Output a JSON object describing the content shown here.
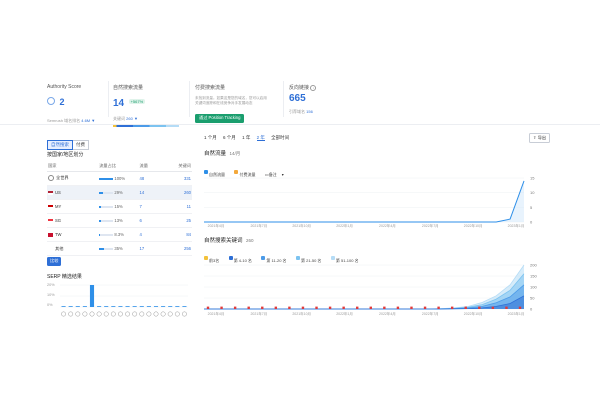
{
  "colors": {
    "accent": "#2e6fd6",
    "green": "#1a9e6e",
    "orange": "#f3a83b",
    "line": "#2e8fe8"
  },
  "header": {
    "authority": {
      "label": "Authority Score",
      "value": "2"
    },
    "semrush": {
      "label": "Semrush 域名排名",
      "value": "4.6M",
      "arrow": "▼"
    },
    "organic": {
      "label": "自然搜索流量",
      "value": "14",
      "badge": "+567%",
      "keywords_label": "关键词",
      "keywords_value": "260",
      "arrow": "▼"
    },
    "paid": {
      "label": "付费搜索流量",
      "desc1": "未找到流量。如果这是您的域名，您可以启用",
      "desc2": "关键词追踪和在线竞争对手发展动态",
      "button": "通过 Position Tracking"
    },
    "backlinks": {
      "label": "反向链接",
      "value": "665",
      "refdomains_label": "引荐域名",
      "refdomains_value": "156"
    }
  },
  "left": {
    "tabs": [
      "自然搜索",
      "付费"
    ],
    "section_title": "按国家/地区划分",
    "table": {
      "headers": [
        "国家",
        "流量占比",
        "流量",
        "关键词"
      ],
      "rows": [
        {
          "flag": "globe",
          "country": "全世界",
          "share": "100%",
          "pct": 100,
          "traffic": "48",
          "keywords": "331"
        },
        {
          "flag": "us",
          "country": "US",
          "share": "29%",
          "pct": 29,
          "traffic": "14",
          "keywords": "260"
        },
        {
          "flag": "my",
          "country": "MY",
          "share": "15%",
          "pct": 15,
          "traffic": "7",
          "keywords": "11"
        },
        {
          "flag": "sg",
          "country": "SG",
          "share": "13%",
          "pct": 13,
          "traffic": "6",
          "keywords": "25"
        },
        {
          "flag": "tw",
          "country": "TW",
          "share": "8.3%",
          "pct": 8.3,
          "traffic": "4",
          "keywords": "84"
        },
        {
          "flag": "none",
          "country": "其他",
          "share": "35%",
          "pct": 35,
          "traffic": "17",
          "keywords": "256"
        }
      ]
    },
    "compare_button": "比较",
    "serp": {
      "title": "SERP 精选结果",
      "yticks": [
        "20%",
        "10%",
        "0%"
      ],
      "bars": [
        0,
        0,
        0,
        0,
        20,
        0,
        0,
        0,
        0,
        0,
        0,
        0,
        0,
        0,
        0,
        0,
        0,
        0
      ]
    }
  },
  "right": {
    "time_tabs": [
      "1 个月",
      "6 个月",
      "1 年",
      "2 年",
      "全部时间"
    ],
    "export_label": "导出",
    "traffic": {
      "title": "自然流量",
      "subtitle": "14/月",
      "legend": {
        "organic": "自然流量",
        "paid": "付费流量",
        "notes": "备注"
      }
    },
    "keywords": {
      "title": "自然搜索关键词",
      "count": "260",
      "legend": [
        "前3名",
        "第 4-10 名",
        "第 11-20 名",
        "第 21-50 名",
        "第 51-100 名"
      ]
    }
  },
  "chart_data": [
    {
      "type": "line",
      "title": "自然流量",
      "x": [
        "2021年4月",
        "2021年7月",
        "2021年10月",
        "2022年1月",
        "2022年4月",
        "2022年7月",
        "2022年10月",
        "2023年1月"
      ],
      "xlabel": "",
      "ylabel": "",
      "ylim": [
        0,
        15
      ],
      "yticks": [
        0,
        5,
        10,
        15
      ],
      "series": [
        {
          "name": "自然流量",
          "values": [
            0,
            0,
            0,
            0,
            0,
            0,
            0,
            0,
            0,
            0,
            0,
            0,
            0,
            0,
            0,
            0,
            0,
            0,
            0,
            0,
            0,
            0,
            1,
            14
          ]
        }
      ]
    },
    {
      "type": "area",
      "title": "自然搜索关键词",
      "x": [
        "2021年4月",
        "2021年7月",
        "2021年10月",
        "2022年1月",
        "2022年4月",
        "2022年7月",
        "2022年10月",
        "2023年1月"
      ],
      "xlabel": "",
      "ylabel": "",
      "ylim": [
        0,
        200
      ],
      "yticks": [
        0,
        50,
        100,
        150,
        200
      ],
      "series": [
        {
          "name": "第 51-100 名",
          "values": [
            0,
            0,
            0,
            0,
            0,
            0,
            0,
            0,
            0,
            0,
            0,
            0,
            0,
            0,
            0,
            0,
            0,
            2,
            5,
            12,
            30,
            60,
            110,
            200
          ]
        },
        {
          "name": "第 21-50 名",
          "values": [
            0,
            0,
            0,
            0,
            0,
            0,
            0,
            0,
            0,
            0,
            0,
            0,
            0,
            0,
            0,
            0,
            0,
            1,
            3,
            8,
            20,
            45,
            85,
            160
          ]
        },
        {
          "name": "第 11-20 名",
          "values": [
            0,
            0,
            0,
            0,
            0,
            0,
            0,
            0,
            0,
            0,
            0,
            0,
            0,
            0,
            0,
            0,
            0,
            0,
            2,
            5,
            12,
            28,
            55,
            110
          ]
        },
        {
          "name": "第 4-10 名",
          "values": [
            0,
            0,
            0,
            0,
            0,
            0,
            0,
            0,
            0,
            0,
            0,
            0,
            0,
            0,
            0,
            0,
            0,
            0,
            1,
            2,
            5,
            12,
            25,
            60
          ]
        }
      ]
    },
    {
      "type": "bar",
      "title": "SERP 精选结果",
      "categories": [
        "1",
        "2",
        "3",
        "4",
        "5",
        "6",
        "7",
        "8",
        "9",
        "10",
        "11",
        "12",
        "13",
        "14",
        "15",
        "16",
        "17",
        "18"
      ],
      "values": [
        0,
        0,
        0,
        0,
        20,
        0,
        0,
        0,
        0,
        0,
        0,
        0,
        0,
        0,
        0,
        0,
        0,
        0
      ],
      "ylim": [
        0,
        20
      ]
    }
  ]
}
